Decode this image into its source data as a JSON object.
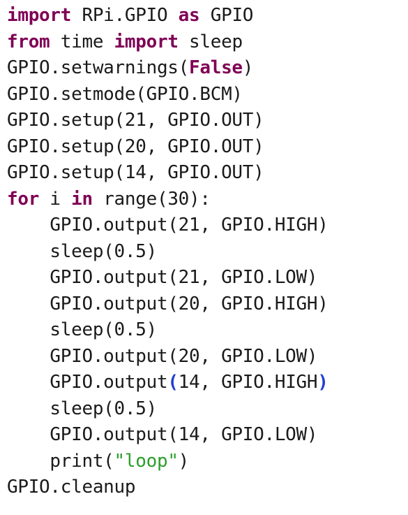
{
  "colors": {
    "background": "#ffffff",
    "text": "#1a1a1a",
    "keyword": "#7f0055",
    "string": "#2a9e2a",
    "bracket_highlight": "#1f3fd6"
  },
  "lines": [
    {
      "tokens": [
        {
          "t": "kw",
          "v": "import"
        },
        {
          "t": "plain",
          "v": " RPi.GPIO "
        },
        {
          "t": "kw",
          "v": "as"
        },
        {
          "t": "plain",
          "v": " GPIO"
        }
      ]
    },
    {
      "tokens": [
        {
          "t": "kw",
          "v": "from"
        },
        {
          "t": "plain",
          "v": " time "
        },
        {
          "t": "kw",
          "v": "import"
        },
        {
          "t": "plain",
          "v": " sleep"
        }
      ]
    },
    {
      "tokens": [
        {
          "t": "plain",
          "v": "GPIO.setwarnings("
        },
        {
          "t": "kw",
          "v": "False"
        },
        {
          "t": "plain",
          "v": ")"
        }
      ]
    },
    {
      "tokens": [
        {
          "t": "plain",
          "v": "GPIO.setmode(GPIO.BCM)"
        }
      ]
    },
    {
      "tokens": [
        {
          "t": "plain",
          "v": "GPIO.setup(21, GPIO.OUT)"
        }
      ]
    },
    {
      "tokens": [
        {
          "t": "plain",
          "v": "GPIO.setup(20, GPIO.OUT)"
        }
      ]
    },
    {
      "tokens": [
        {
          "t": "plain",
          "v": "GPIO.setup(14, GPIO.OUT)"
        }
      ]
    },
    {
      "tokens": [
        {
          "t": "kw",
          "v": "for"
        },
        {
          "t": "plain",
          "v": " i "
        },
        {
          "t": "kw",
          "v": "in"
        },
        {
          "t": "plain",
          "v": " range(30):"
        }
      ]
    },
    {
      "tokens": [
        {
          "t": "plain",
          "v": "    GPIO.output(21, GPIO.HIGH)"
        }
      ]
    },
    {
      "tokens": [
        {
          "t": "plain",
          "v": "    sleep(0.5)"
        }
      ]
    },
    {
      "tokens": [
        {
          "t": "plain",
          "v": "    GPIO.output(21, GPIO.LOW)"
        }
      ]
    },
    {
      "tokens": [
        {
          "t": "plain",
          "v": "    GPIO.output(20, GPIO.HIGH)"
        }
      ]
    },
    {
      "tokens": [
        {
          "t": "plain",
          "v": "    sleep(0.5)"
        }
      ]
    },
    {
      "tokens": [
        {
          "t": "plain",
          "v": "    GPIO.output(20, GPIO.LOW)"
        }
      ]
    },
    {
      "tokens": [
        {
          "t": "plain",
          "v": "    GPIO.output"
        },
        {
          "t": "paren",
          "v": "("
        },
        {
          "t": "plain",
          "v": "14, GPIO.HIGH"
        },
        {
          "t": "paren",
          "v": ")"
        }
      ]
    },
    {
      "tokens": [
        {
          "t": "plain",
          "v": "    sleep(0.5)"
        }
      ]
    },
    {
      "tokens": [
        {
          "t": "plain",
          "v": "    GPIO.output(14, GPIO.LOW)"
        }
      ]
    },
    {
      "tokens": [
        {
          "t": "plain",
          "v": "    print("
        },
        {
          "t": "str",
          "v": "\"loop\""
        },
        {
          "t": "plain",
          "v": ")"
        }
      ]
    },
    {
      "tokens": [
        {
          "t": "plain",
          "v": "GPIO.cleanup"
        }
      ]
    }
  ]
}
